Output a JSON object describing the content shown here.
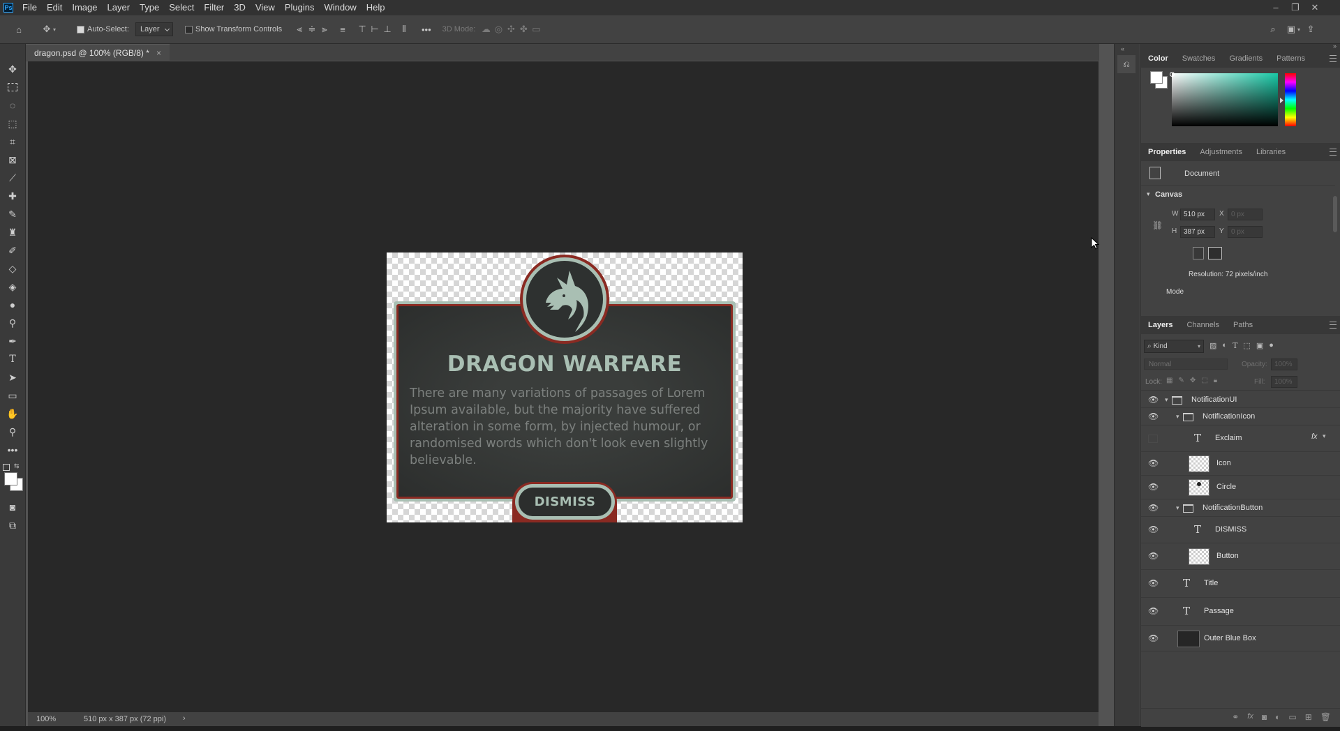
{
  "app": {
    "logo": "Ps"
  },
  "menu": [
    "File",
    "Edit",
    "Image",
    "Layer",
    "Type",
    "Select",
    "Filter",
    "3D",
    "View",
    "Plugins",
    "Window",
    "Help"
  ],
  "window_controls": {
    "minimize": "–",
    "restore": "❐",
    "close": "✕"
  },
  "options_bar": {
    "auto_select_label": "Auto-Select:",
    "auto_select_checked": true,
    "auto_select_target": "Layer",
    "show_transform_controls_label": "Show Transform Controls",
    "show_transform_controls_checked": false,
    "more_label": "•••",
    "mode_3d_label": "3D Mode:"
  },
  "document_tab": {
    "title": "dragon.psd @ 100% (RGB/8) *",
    "close": "×"
  },
  "status_bar": {
    "zoom": "100%",
    "info": "510 px x 387 px (72 ppi)",
    "arrow": "›"
  },
  "document": {
    "title": "DRAGON WARFARE",
    "passage": "There are many variations of passages of Lorem Ipsum available, but the majority have suffered alteration in some form, by injected humour, or randomised words which don't look even slightly believable.",
    "button": "DISMISS",
    "colors": {
      "sage": "#a9bfb3",
      "frame_red": "#8a2a22",
      "panel_dark": "#2e3130",
      "text_gray": "#7c807e"
    }
  },
  "color_panel": {
    "tabs": [
      "Color",
      "Swatches",
      "Gradients",
      "Patterns"
    ],
    "active": "Color"
  },
  "properties_panel": {
    "tabs": [
      "Properties",
      "Adjustments",
      "Libraries"
    ],
    "active": "Properties",
    "document_label": "Document",
    "canvas_section": "Canvas",
    "w_label": "W",
    "w_value": "510 px",
    "h_label": "H",
    "h_value": "387 px",
    "x_label": "X",
    "x_value": "0 px",
    "y_label": "Y",
    "y_value": "0 px",
    "resolution": "Resolution: 72 pixels/inch",
    "mode_label": "Mode"
  },
  "layers_panel": {
    "tabs": [
      "Layers",
      "Channels",
      "Paths"
    ],
    "active": "Layers",
    "filter_kind": "Kind",
    "blend_mode": "Normal",
    "opacity_label": "Opacity:",
    "opacity_value": "100%",
    "lock_label": "Lock:",
    "fill_label": "Fill:",
    "fill_value": "100%",
    "layers": [
      {
        "name": "NotificationUI",
        "type": "group",
        "depth": 0,
        "visible": true
      },
      {
        "name": "NotificationIcon",
        "type": "group",
        "depth": 1,
        "visible": true
      },
      {
        "name": "Exclaim",
        "type": "text",
        "depth": 2,
        "visible": false,
        "fx": "fx"
      },
      {
        "name": "Icon",
        "type": "pixel",
        "depth": 2,
        "visible": true
      },
      {
        "name": "Circle",
        "type": "pixel",
        "depth": 2,
        "visible": true
      },
      {
        "name": "NotificationButton",
        "type": "group",
        "depth": 1,
        "visible": true
      },
      {
        "name": "DISMISS",
        "type": "text",
        "depth": 2,
        "visible": true
      },
      {
        "name": "Button",
        "type": "pixel",
        "depth": 2,
        "visible": true
      },
      {
        "name": "Title",
        "type": "text",
        "depth": 1,
        "visible": true
      },
      {
        "name": "Passage",
        "type": "text",
        "depth": 1,
        "visible": true
      },
      {
        "name": "Outer Blue Box",
        "type": "pixel",
        "depth": 1,
        "visible": true
      }
    ]
  }
}
